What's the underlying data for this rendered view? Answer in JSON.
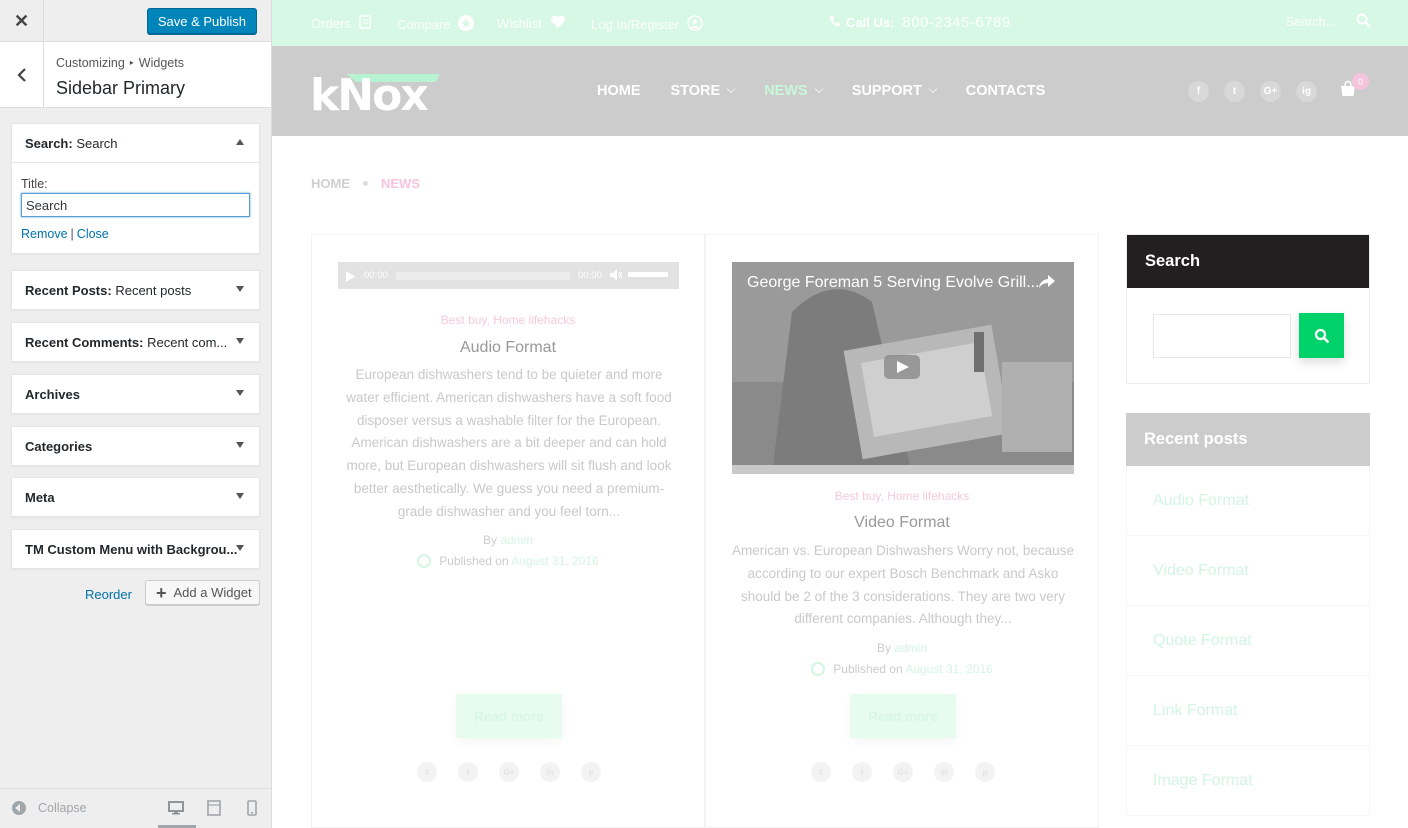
{
  "customizer": {
    "close_icon": "close-icon",
    "save_publish": "Save & Publish",
    "breadcrumb": [
      "Customizing",
      "Widgets"
    ],
    "section_title": "Sidebar Primary",
    "widgets": [
      {
        "type": "Search:",
        "title": "Search",
        "expanded": true
      },
      {
        "type": "Recent Posts:",
        "title": "Recent posts",
        "expanded": false
      },
      {
        "type": "Recent Comments:",
        "title": "Recent com...",
        "expanded": false
      },
      {
        "type": "Archives",
        "title": "",
        "expanded": false
      },
      {
        "type": "Categories",
        "title": "",
        "expanded": false
      },
      {
        "type": "Meta",
        "title": "",
        "expanded": false
      },
      {
        "type": "TM Custom Menu with Backgrou...",
        "title": "",
        "expanded": false
      }
    ],
    "search_widget_form": {
      "title_label": "Title:",
      "title_value": "Search",
      "remove_link": "Remove",
      "separator": "|",
      "close_link": "Close"
    },
    "reorder": "Reorder",
    "add_widget": "Add a Widget",
    "collapse": "Collapse",
    "devices": [
      "desktop",
      "tablet",
      "mobile"
    ],
    "accent_color": "#0085ba"
  },
  "site": {
    "topbar": {
      "links": [
        "Orders",
        "Compare",
        "Wishlist",
        "Log In/Register"
      ],
      "call_label": "Call Us:",
      "phone": "800-2345-6789",
      "search_placeholder": "Search..."
    },
    "logo": "kNox",
    "nav": [
      {
        "label": "HOME",
        "dropdown": false,
        "active": false
      },
      {
        "label": "STORE",
        "dropdown": true,
        "active": false
      },
      {
        "label": "NEWS",
        "dropdown": true,
        "active": true
      },
      {
        "label": "SUPPORT",
        "dropdown": true,
        "active": false
      },
      {
        "label": "CONTACTS",
        "dropdown": false,
        "active": false
      }
    ],
    "social": [
      "f",
      "t",
      "G+",
      "ig"
    ],
    "cart_count": "0",
    "breadcrumb": {
      "home": "HOME",
      "current": "NEWS"
    },
    "posts": [
      {
        "categories": "Best buy, Home lifehacks",
        "title": "Audio Format",
        "excerpt": "European dishwashers tend to be quieter and more water efficient. American dishwashers have a soft food disposer versus a washable filter for the European. American dishwashers are a bit deeper and can hold more, but European dishwashers will sit flush and look better aesthetically. We guess you need a premium-grade dishwasher and you feel torn...",
        "by_label": "By",
        "author": "admin",
        "published_label": "Published on",
        "date": "August 31, 2016",
        "read_more": "Read more",
        "player_time_start": "00:00",
        "player_time_end": "00:00"
      },
      {
        "categories": "Best buy, Home lifehacks",
        "title": "Video Format",
        "video_title": "George Foreman 5 Serving Evolve Grill...",
        "excerpt": "American vs. European Dishwashers Worry not, because according to our expert Bosch Benchmark and Asko should be 2 of the 3 considerations. They are two very different companies. Although they...",
        "by_label": "By",
        "author": "admin",
        "published_label": "Published on",
        "date": "August 31, 2016",
        "read_more": "Read more"
      }
    ],
    "post_share": [
      "f",
      "t",
      "G+",
      "in",
      "p"
    ],
    "sidebar": {
      "search_title": "Search",
      "recent_title": "Recent posts",
      "recent_items": [
        "Audio Format",
        "Video Format",
        "Quote Format",
        "Link Format",
        "Image Format"
      ]
    },
    "colors": {
      "brand_green": "#00d26a",
      "dark": "#221f20",
      "pink": "#f8c4dd"
    }
  }
}
